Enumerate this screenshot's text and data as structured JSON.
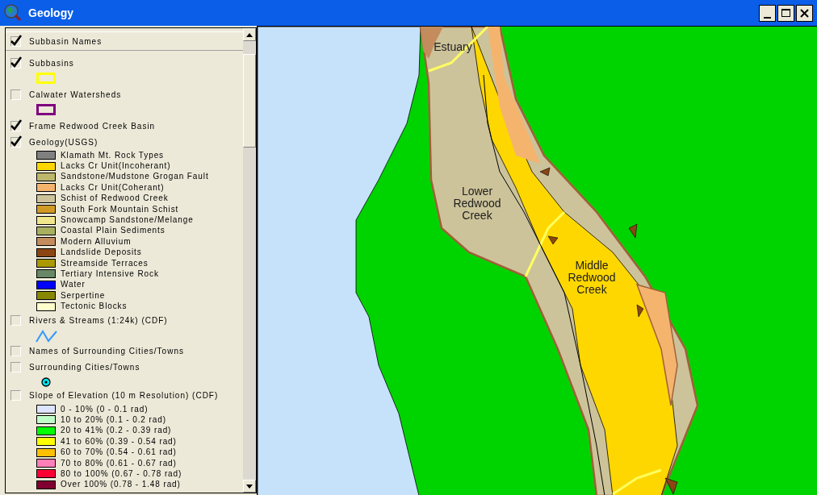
{
  "window": {
    "title": "Geology"
  },
  "layers": [
    {
      "name": "Subbasin Names",
      "checked": true,
      "selected": true
    },
    {
      "name": "Subbasins",
      "checked": true,
      "selected": false,
      "legend": {
        "kind": "outline",
        "color": "#ffff00"
      }
    },
    {
      "name": "Calwater Watersheds",
      "checked": false,
      "selected": false,
      "legend": {
        "kind": "outline",
        "color": "#800080"
      }
    },
    {
      "name": "Frame Redwood Creek Basin",
      "checked": true,
      "selected": false
    },
    {
      "name": "Geology(USGS)",
      "checked": true,
      "selected": false,
      "legend": {
        "kind": "classes",
        "classes": [
          {
            "label": "Klamath Mt. Rock Types",
            "color": "#808080"
          },
          {
            "label": "Lacks Cr Unit(Incoherant)",
            "color": "#ffd700"
          },
          {
            "label": "Sandstone/Mudstone Grogan Fault",
            "color": "#bdb76b"
          },
          {
            "label": "Lacks Cr Unit(Coherant)",
            "color": "#f4b46e"
          },
          {
            "label": "Schist of Redwood Creek",
            "color": "#cdc39a"
          },
          {
            "label": "South Fork Mountain Schist",
            "color": "#d09a24"
          },
          {
            "label": "Snowcamp Sandstone/Melange",
            "color": "#f0e68c"
          },
          {
            "label": "Coastal Plain Sediments",
            "color": "#a8b060"
          },
          {
            "label": "Modern Alluvium",
            "color": "#c48c5c"
          },
          {
            "label": "Landslide Deposits",
            "color": "#8b4513"
          },
          {
            "label": "Streamside Terraces",
            "color": "#aa9900"
          },
          {
            "label": "Tertiary Intensive Rock",
            "color": "#668866"
          },
          {
            "label": "Water",
            "color": "#0000ff"
          },
          {
            "label": "Serpertine",
            "color": "#888800"
          },
          {
            "label": "Tectonic Blocks",
            "color": "#ffffcc"
          }
        ]
      }
    },
    {
      "name": "Rivers & Streams (1:24k) (CDF)",
      "checked": false,
      "selected": false,
      "legend": {
        "kind": "line",
        "color": "#3399ff"
      }
    },
    {
      "name": "Names of Surrounding Cities/Towns",
      "checked": false,
      "selected": false
    },
    {
      "name": "Surrounding Cities/Towns",
      "checked": false,
      "selected": false,
      "legend": {
        "kind": "point",
        "color": "#00e5ee"
      }
    },
    {
      "name": "Slope of Elevation (10 m Resolution) (CDF)",
      "checked": false,
      "selected": false,
      "legend": {
        "kind": "classes",
        "classes": [
          {
            "label": "0 - 10% (0 - 0.1 rad)",
            "color": "#dde4ff"
          },
          {
            "label": "10 to 20% (0.1 - 0.2 rad)",
            "color": "#c0ffc8"
          },
          {
            "label": "20 to 41% (0.2 - 0.39 rad)",
            "color": "#00ff00"
          },
          {
            "label": "41 to 60% (0.39 - 0.54 rad)",
            "color": "#ffff00"
          },
          {
            "label": "60 to 70% (0.54 - 0.61 rad)",
            "color": "#ffc000"
          },
          {
            "label": "70 to 80% (0.61 - 0.67 rad)",
            "color": "#ff80b8"
          },
          {
            "label": "80 to 100% (0.67 - 0.78 rad)",
            "color": "#ff0033"
          },
          {
            "label": "Over 100% (0.78 - 1.48 rad)",
            "color": "#800030"
          }
        ]
      }
    }
  ],
  "map": {
    "labels": [
      {
        "text": "Estuary"
      },
      {
        "text": "Lower Redwood Creek"
      },
      {
        "text": "Middle Redwood Creek"
      }
    ]
  }
}
